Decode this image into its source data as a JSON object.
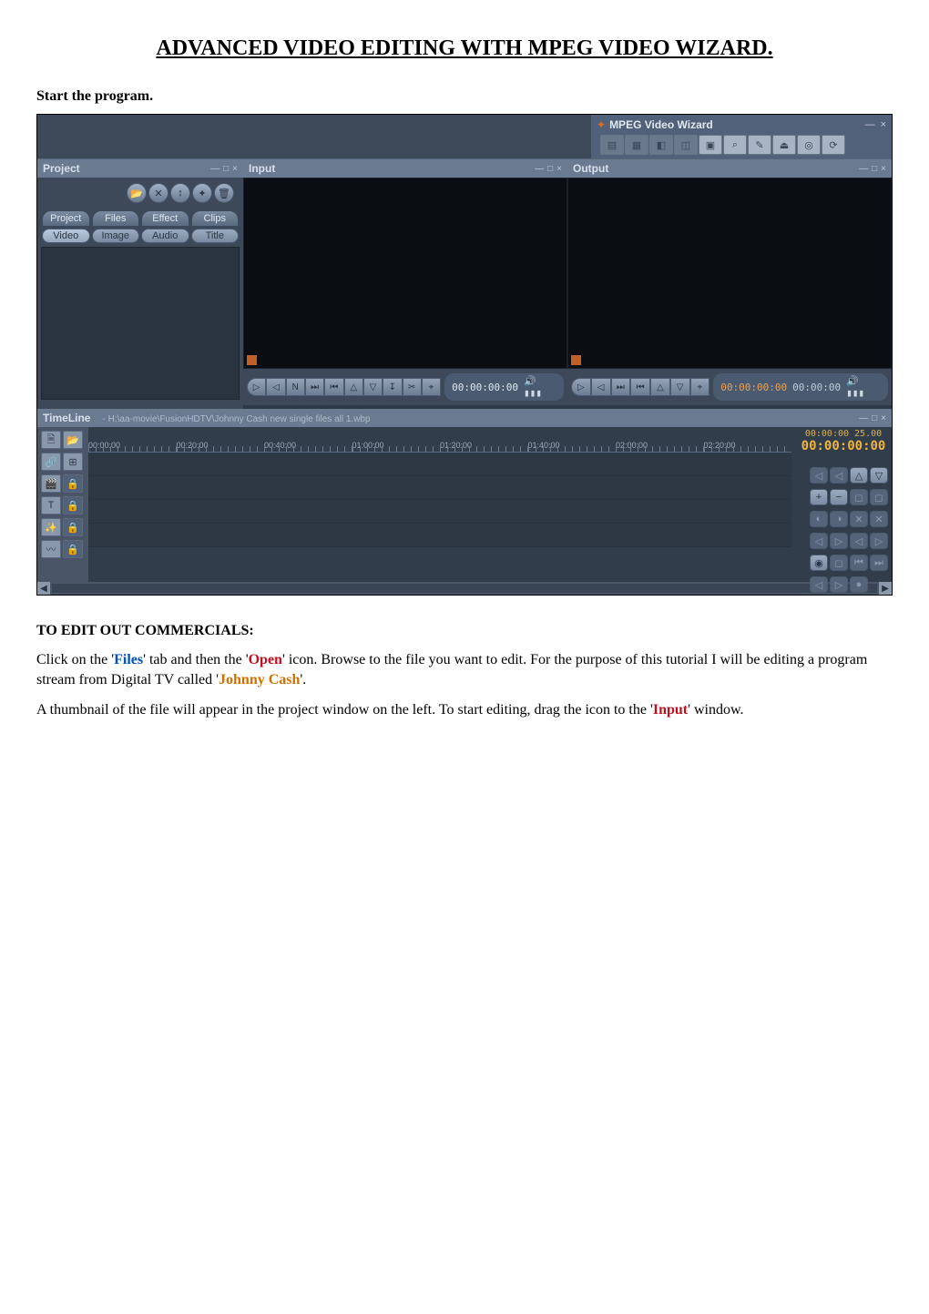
{
  "doc": {
    "title": "ADVANCED VIDEO EDITING WITH MPEG VIDEO WIZARD.",
    "start_heading": "Start the program.",
    "edit_heading": "TO EDIT OUT COMMERCIALS:",
    "para1_a": "Click on the '",
    "para1_files": "Files",
    "para1_b": "' tab and then the '",
    "para1_open": "Open",
    "para1_c": "' icon.  Browse to the file you want to edit. For the purpose of this tutorial I will be editing a program stream from Digital TV called '",
    "para1_jc": "Johnny Cash",
    "para1_d": "'.",
    "para2_a": "A thumbnail of the file will appear in the project window on the left.  To start editing, drag the icon to the '",
    "para2_input": "Input",
    "para2_b": "' window."
  },
  "app": {
    "title": "MPEG Video Wizard",
    "panels": {
      "project": "Project",
      "input": "Input",
      "output": "Output",
      "timeline": "TimeLine"
    },
    "tabs1": {
      "project": "Project",
      "files": "Files",
      "effect": "Effect",
      "clips": "Clips"
    },
    "tabs2": {
      "video": "Video",
      "image": "Image",
      "audio": "Audio",
      "title": "Title"
    },
    "input_time": "00:00:00:00",
    "output_time1": "00:00:00:00",
    "output_time2": "00:00:00",
    "timeline_path": "- H:\\aa-movie\\FusionHDTV\\Johnny Cash new single files all 1.wbp",
    "ruler": [
      "00:00:00",
      "00:20:00",
      "00:40:00",
      "01:00:00",
      "01:20:00",
      "01:40:00",
      "02:00:00",
      "02:20:00"
    ],
    "tl_small": "00:00:00   25.00",
    "tl_big": "00:00:00:00",
    "wc": {
      "min": "—",
      "max": "□",
      "close": "×"
    },
    "ctrl": {
      "play": "▷",
      "back": "◁",
      "next": "N",
      "end": "⏭",
      "start": "⏮",
      "up": "△",
      "down": "▽",
      "markin": "↧",
      "cut": "✂",
      "snap": "⌖",
      "plus": "+",
      "minus": "−",
      "eye": "◉",
      "rec": "●"
    }
  }
}
